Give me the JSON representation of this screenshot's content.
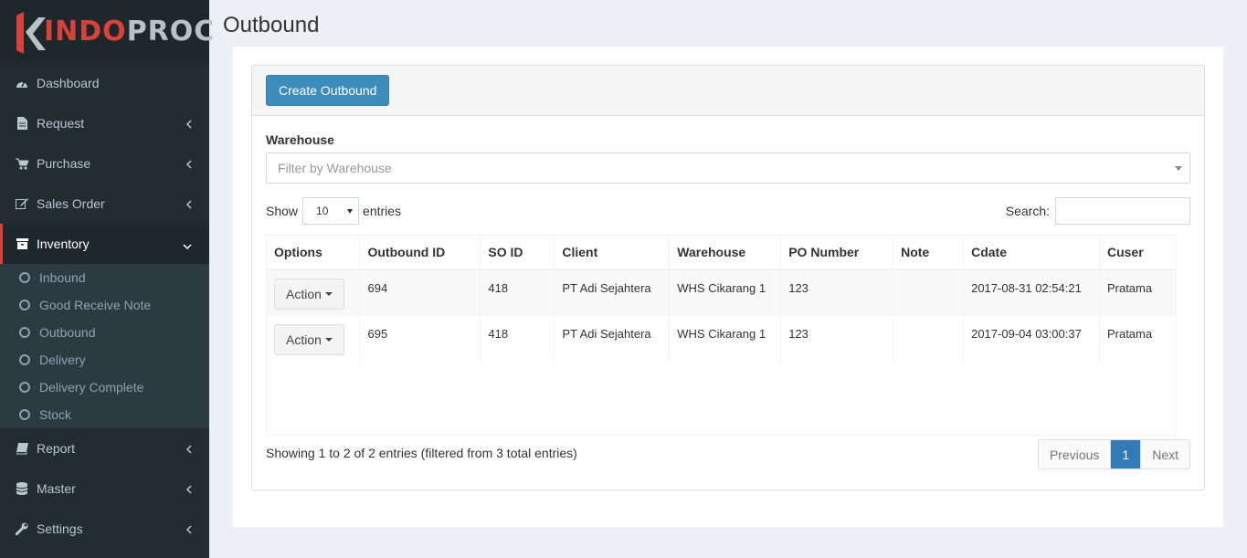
{
  "brand": {
    "logo_text_red": "INDO",
    "logo_text_grey": "PROC"
  },
  "sidebar": {
    "items": [
      {
        "label": "Dashboard",
        "icon": "dashboard-icon"
      },
      {
        "label": "Request",
        "icon": "file-icon"
      },
      {
        "label": "Purchase",
        "icon": "cart-icon"
      },
      {
        "label": "Sales Order",
        "icon": "edit-icon"
      },
      {
        "label": "Inventory",
        "icon": "archive-icon"
      },
      {
        "label": "Report",
        "icon": "book-icon"
      },
      {
        "label": "Master",
        "icon": "database-icon"
      },
      {
        "label": "Settings",
        "icon": "wrench-icon"
      }
    ],
    "inventory_sub": [
      {
        "label": "Inbound"
      },
      {
        "label": "Good Receive Note"
      },
      {
        "label": "Outbound"
      },
      {
        "label": "Delivery"
      },
      {
        "label": "Delivery Complete"
      },
      {
        "label": "Stock"
      }
    ]
  },
  "page": {
    "title": "Outbound"
  },
  "toolbar": {
    "create_label": "Create Outbound"
  },
  "filter": {
    "warehouse_label": "Warehouse",
    "warehouse_placeholder": "Filter by Warehouse"
  },
  "table_controls": {
    "show": "Show",
    "page_length": "10",
    "entries": "entries",
    "search_label": "Search:",
    "search_value": ""
  },
  "table": {
    "columns": [
      "Options",
      "Outbound ID",
      "SO ID",
      "Client",
      "Warehouse",
      "PO Number",
      "Note",
      "Cdate",
      "Cuser"
    ],
    "rows": [
      {
        "action": "Action",
        "outbound_id": "694",
        "so_id": "418",
        "client": "PT Adi Sejahtera",
        "warehouse": "WHS Cikarang 1",
        "po_number": "123",
        "note": "",
        "cdate": "2017-08-31 02:54:21",
        "cuser": "Pratama"
      },
      {
        "action": "Action",
        "outbound_id": "695",
        "so_id": "418",
        "client": "PT Adi Sejahtera",
        "warehouse": "WHS Cikarang 1",
        "po_number": "123",
        "note": "",
        "cdate": "2017-09-04 03:00:37",
        "cuser": "Pratama"
      }
    ]
  },
  "footer": {
    "info": "Showing 1 to 2 of 2 entries (filtered from 3 total entries)",
    "prev": "Previous",
    "current_page": "1",
    "next": "Next"
  },
  "colors": {
    "sidebar_bg": "#222d32",
    "accent": "#3c8dbc",
    "active_border": "#d9413b"
  }
}
